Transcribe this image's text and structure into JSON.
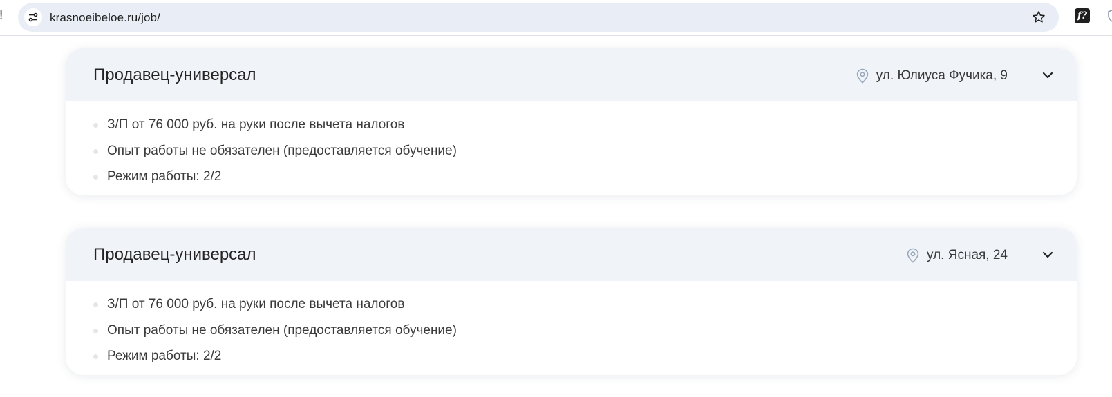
{
  "browser": {
    "edge_glyph": "!",
    "url": "krasnoeibeloe.ru/job/",
    "extension_label": "f?"
  },
  "jobs": [
    {
      "title": "Продавец-универсал",
      "address": "ул. Юлиуса Фучика, 9",
      "details": [
        "З/П от 76 000 руб. на руки после вычета налогов",
        "Опыт работы не обязателен (предоставляется обучение)",
        "Режим работы: 2/2"
      ]
    },
    {
      "title": "Продавец-универсал",
      "address": "ул. Ясная, 24",
      "details": [
        "З/П от 76 000 руб. на руки после вычета налогов",
        "Опыт работы не обязателен (предоставляется обучение)",
        "Режим работы: 2/2"
      ]
    }
  ],
  "icons": {
    "site_info": "tune-icon",
    "bookmark": "star-icon",
    "location": "map-pin-icon",
    "expand": "chevron-down-icon"
  },
  "colors": {
    "card_header_bg": "#f0f3f7",
    "omnibox_bg": "#e9eef6",
    "pin_color": "#9aa8bb"
  }
}
